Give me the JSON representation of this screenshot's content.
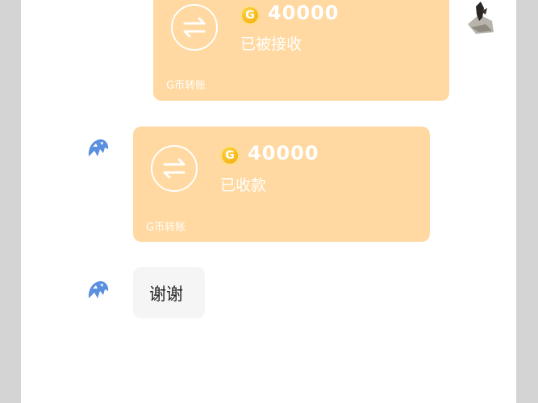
{
  "chat": {
    "messages": [
      {
        "type": "transfer",
        "side": "right",
        "amount": "40000",
        "status": "已被接收",
        "label": "G币转账",
        "coin_symbol": "G"
      },
      {
        "type": "transfer",
        "side": "left",
        "amount": "40000",
        "status": "已收款",
        "label": "G币转账",
        "coin_symbol": "G"
      },
      {
        "type": "text",
        "side": "left",
        "text": "谢谢"
      }
    ]
  },
  "colors": {
    "card_background": "#ffd9a1",
    "text_bubble_background": "#f5f5f5",
    "coin": "#f6b51a",
    "avatar_left": "#5b8fe0"
  },
  "icons": {
    "transfer": "transfer-arrows-icon",
    "coin": "coin-icon",
    "avatar_right": "avatar",
    "avatar_left": "avatar"
  }
}
